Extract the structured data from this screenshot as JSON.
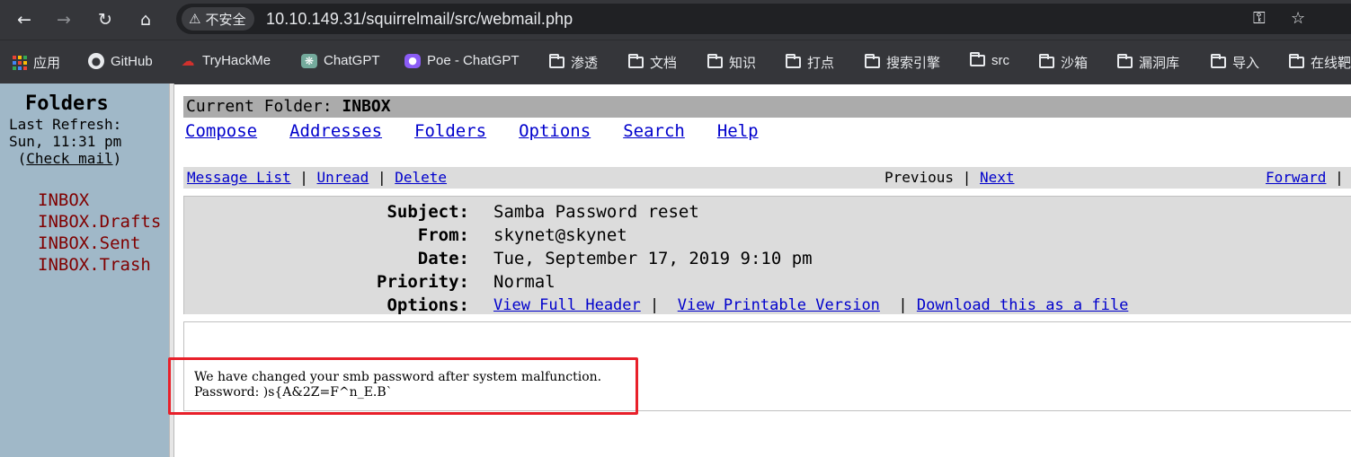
{
  "browser": {
    "security_label": "不安全",
    "url": "10.10.149.31/squirrelmail/src/webmail.php",
    "bookmarks": [
      {
        "label": "应用",
        "icon": "apps-grid-icon"
      },
      {
        "label": "GitHub",
        "icon": "github-icon"
      },
      {
        "label": "TryHackMe",
        "icon": "tryhackme-icon"
      },
      {
        "label": "ChatGPT",
        "icon": "chatgpt-icon"
      },
      {
        "label": "Poe - ChatGPT",
        "icon": "poe-icon"
      },
      {
        "label": "渗透",
        "icon": "folder-icon"
      },
      {
        "label": "文档",
        "icon": "folder-icon"
      },
      {
        "label": "知识",
        "icon": "folder-icon"
      },
      {
        "label": "打点",
        "icon": "folder-icon"
      },
      {
        "label": "搜索引擎",
        "icon": "folder-icon"
      },
      {
        "label": "src",
        "icon": "folder-icon"
      },
      {
        "label": "沙箱",
        "icon": "folder-icon"
      },
      {
        "label": "漏洞库",
        "icon": "folder-icon"
      },
      {
        "label": "导入",
        "icon": "folder-icon"
      },
      {
        "label": "在线靶",
        "icon": "folder-icon"
      }
    ]
  },
  "sidebar": {
    "title": "Folders",
    "last_refresh_label": "Last Refresh:",
    "last_refresh_time": "Sun, 11:31 pm",
    "check_mail": "Check mail",
    "folders": [
      "INBOX",
      "INBOX.Drafts",
      "INBOX.Sent",
      "INBOX.Trash"
    ]
  },
  "main": {
    "current_folder_label": "Current Folder: ",
    "current_folder": "INBOX",
    "menu": [
      "Compose",
      "Addresses",
      "Folders",
      "Options",
      "Search",
      "Help"
    ],
    "nav": {
      "message_list": "Message List",
      "unread": "Unread",
      "delete": "Delete",
      "previous": "Previous",
      "next": "Next",
      "forward": "Forward",
      "sep": "|"
    },
    "headers": {
      "subject_label": "Subject:",
      "subject": "Samba Password reset",
      "from_label": "From:",
      "from": "skynet@skynet",
      "date_label": "Date:",
      "date": "Tue, September 17, 2019 9:10 pm",
      "priority_label": "Priority:",
      "priority": "Normal",
      "options_label": "Options:",
      "view_full_header": "View Full Header",
      "view_printable": "View Printable Version",
      "download": "Download this as a file"
    },
    "body": {
      "line1": "We have changed your smb password after system malfunction.",
      "line2": "Password: )s{A&2Z=F^n_E.B`"
    }
  },
  "colors": {
    "chrome_bg": "#35363a",
    "sidebar_bg": "#a0b8c8",
    "folder_text": "#800000",
    "link": "#0000cc",
    "highlight_box": "#e8202a"
  }
}
